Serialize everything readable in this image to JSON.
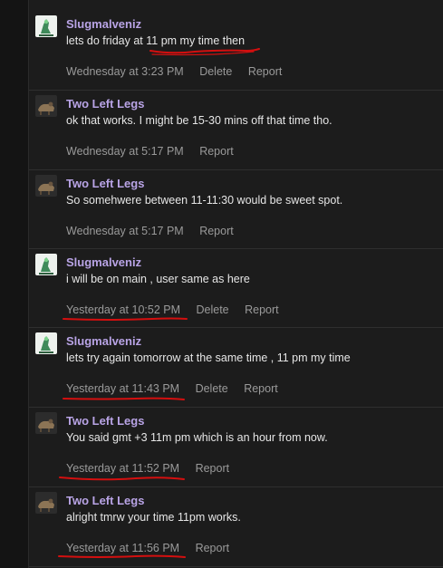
{
  "messages": [
    {
      "username": "Slugmalveniz",
      "avatar": "slug-avatar",
      "text": "lets do friday at 11 pm my time then",
      "time": "Wednesday at 3:23 PM",
      "actions": [
        "Delete",
        "Report"
      ]
    },
    {
      "username": "Two Left Legs",
      "avatar": "legs-avatar",
      "text": "ok that works. I might be 15-30 mins off that time tho.",
      "time": "Wednesday at 5:17 PM",
      "actions": [
        "Report"
      ]
    },
    {
      "username": "Two Left Legs",
      "avatar": "legs-avatar",
      "text": "So somehwere between 11-11:30 would be sweet spot.",
      "time": "Wednesday at 5:17 PM",
      "actions": [
        "Report"
      ]
    },
    {
      "username": "Slugmalveniz",
      "avatar": "slug-avatar",
      "text": "i will be on main , user same as here",
      "time": "Yesterday at 10:52 PM",
      "actions": [
        "Delete",
        "Report"
      ]
    },
    {
      "username": "Slugmalveniz",
      "avatar": "slug-avatar",
      "text": "lets try again tomorrow at the same time , 11 pm my time",
      "time": "Yesterday at 11:43 PM",
      "actions": [
        "Delete",
        "Report"
      ]
    },
    {
      "username": "Two Left Legs",
      "avatar": "legs-avatar",
      "text": "You said gmt +3 11m pm which is an hour from now.",
      "time": "Yesterday at 11:52 PM",
      "actions": [
        "Report"
      ]
    },
    {
      "username": "Two Left Legs",
      "avatar": "legs-avatar",
      "text": "alright tmrw your time 11pm works.",
      "time": "Yesterday at 11:56 PM",
      "actions": [
        "Report"
      ]
    }
  ],
  "colors": {
    "username": "#b9a4e6",
    "annotation": "#d40f0f"
  }
}
